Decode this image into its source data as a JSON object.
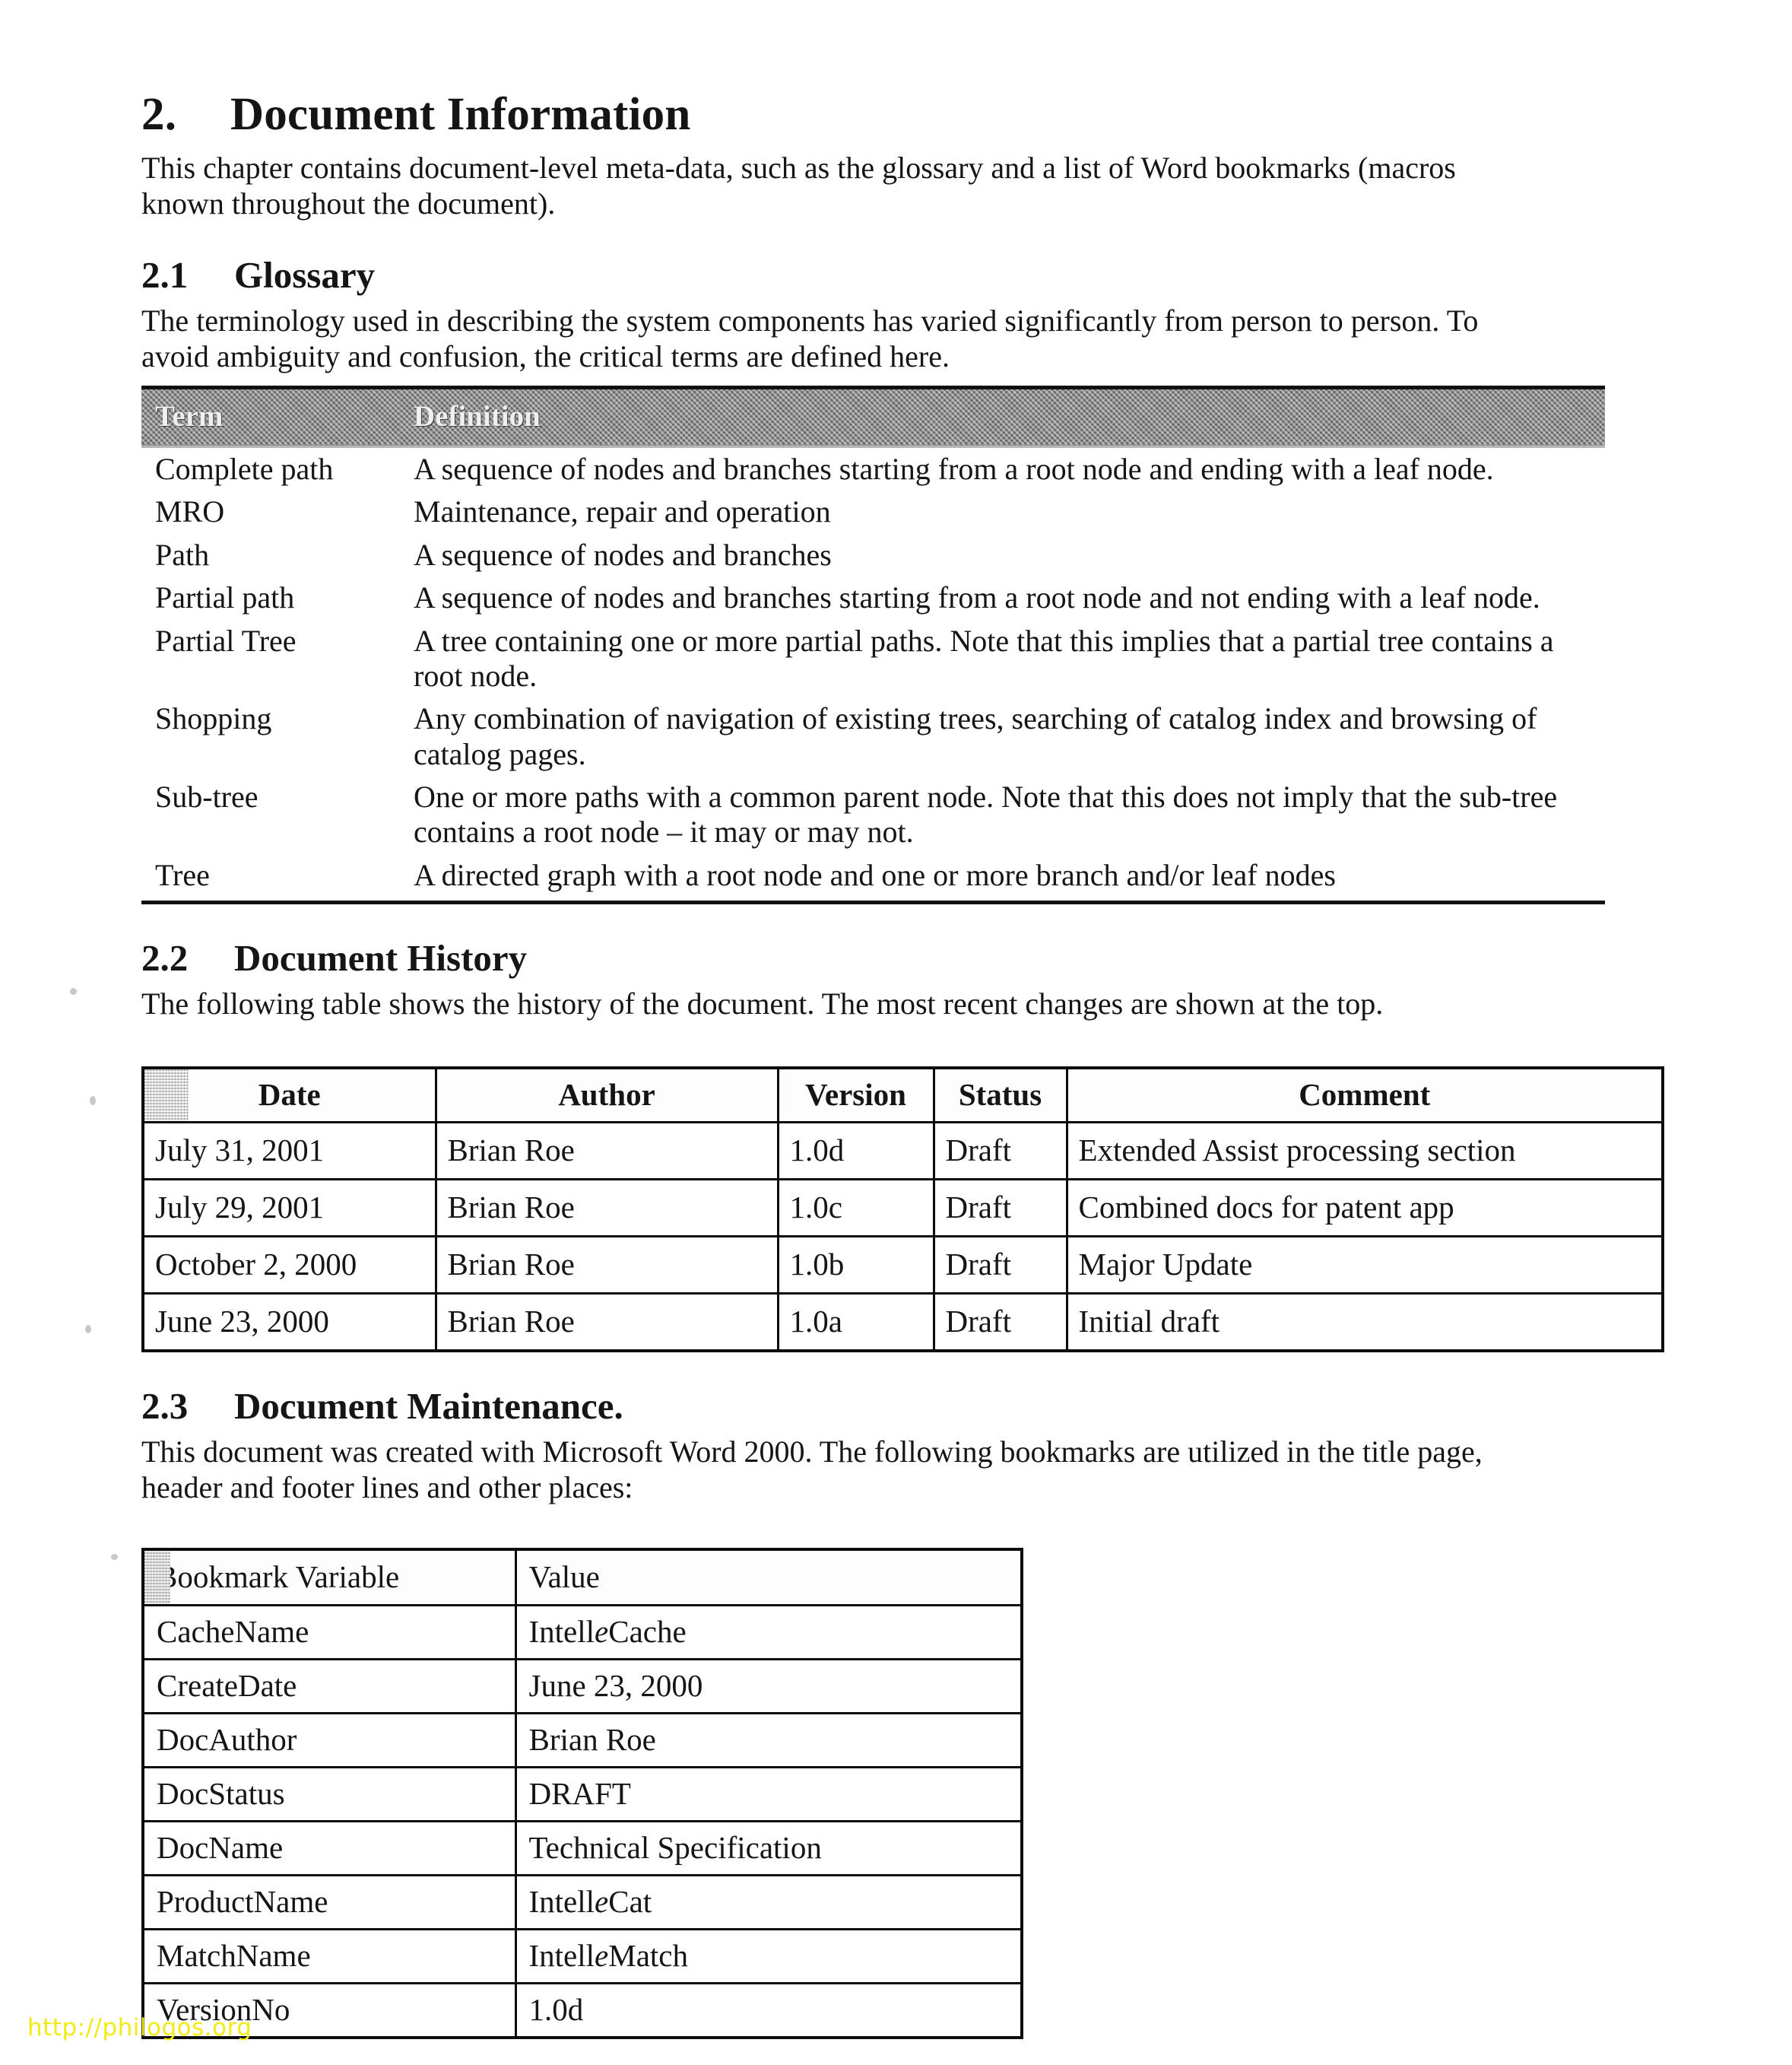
{
  "document": {
    "chapter_number": "2.",
    "chapter_title": "Document Information",
    "intro_paragraph": "This chapter contains document-level meta-data, such as the glossary and a list of Word bookmarks (macros known throughout the document)."
  },
  "glossary_section": {
    "number": "2.1",
    "title": "Glossary",
    "intro": "The terminology used in describing the system components has varied significantly from person to person.  To avoid ambiguity and confusion, the critical terms are defined here.",
    "table": {
      "headers": [
        "Term",
        "Definition"
      ],
      "rows": [
        [
          "Complete path",
          "A sequence of nodes and branches starting from a root node and ending with a leaf node."
        ],
        [
          "MRO",
          "Maintenance, repair and operation"
        ],
        [
          "Path",
          "A sequence of nodes and branches"
        ],
        [
          "Partial path",
          "A sequence of nodes and branches starting from a root node and not ending with a leaf node."
        ],
        [
          "Partial Tree",
          "A tree containing one or more partial paths.  Note that this implies that a partial tree contains a root node."
        ],
        [
          "Shopping",
          "Any combination of navigation of existing trees, searching of catalog index and browsing of catalog pages."
        ],
        [
          "Sub-tree",
          "One or more paths with a common parent node.  Note that this does not imply that the sub-tree contains a root node – it may or may not."
        ],
        [
          "Tree",
          "A directed graph with a root node and one or more branch and/or leaf nodes"
        ]
      ]
    }
  },
  "history_section": {
    "number": "2.2",
    "title": "Document History",
    "intro": "The following table shows the history of the document.  The most recent changes are shown at the top.",
    "table": {
      "headers": [
        "Date",
        "Author",
        "Version",
        "Status",
        "Comment"
      ],
      "rows": [
        [
          "July 31, 2001",
          "Brian Roe",
          "1.0d",
          "Draft",
          "Extended Assist processing section"
        ],
        [
          "July 29, 2001",
          "Brian Roe",
          "1.0c",
          "Draft",
          "Combined docs for patent app"
        ],
        [
          "October 2, 2000",
          "Brian Roe",
          "1.0b",
          "Draft",
          "Major Update"
        ],
        [
          "June 23, 2000",
          "Brian Roe",
          "1.0a",
          "Draft",
          "Initial draft"
        ]
      ]
    }
  },
  "maintenance_section": {
    "number": "2.3",
    "title": "Document Maintenance.",
    "intro": "This document was created with Microsoft Word 2000. The following bookmarks are utilized in the title page, header and footer lines and other places:",
    "table": {
      "headers": [
        "Bookmark Variable",
        "Value"
      ],
      "rows": [
        {
          "variable": "CacheName",
          "value_pre": "Intell",
          "value_ital": "e",
          "value_post": "Cache"
        },
        {
          "variable": "CreateDate",
          "value_pre": "June 23, 2000",
          "value_ital": "",
          "value_post": ""
        },
        {
          "variable": "DocAuthor",
          "value_pre": "Brian Roe",
          "value_ital": "",
          "value_post": ""
        },
        {
          "variable": "DocStatus",
          "value_pre": "DRAFT",
          "value_ital": "",
          "value_post": ""
        },
        {
          "variable": "DocName",
          "value_pre": "Technical Specification",
          "value_ital": "",
          "value_post": ""
        },
        {
          "variable": "ProductName",
          "value_pre": "Intell",
          "value_ital": "e",
          "value_post": "Cat"
        },
        {
          "variable": "MatchName",
          "value_pre": "Intell",
          "value_ital": "e",
          "value_post": "Match"
        },
        {
          "variable": "VersionNo",
          "value_pre": "1.0d",
          "value_ital": "",
          "value_post": ""
        }
      ]
    }
  },
  "watermark": {
    "text": "http://philogos.org",
    "color": "#f2ea14"
  }
}
